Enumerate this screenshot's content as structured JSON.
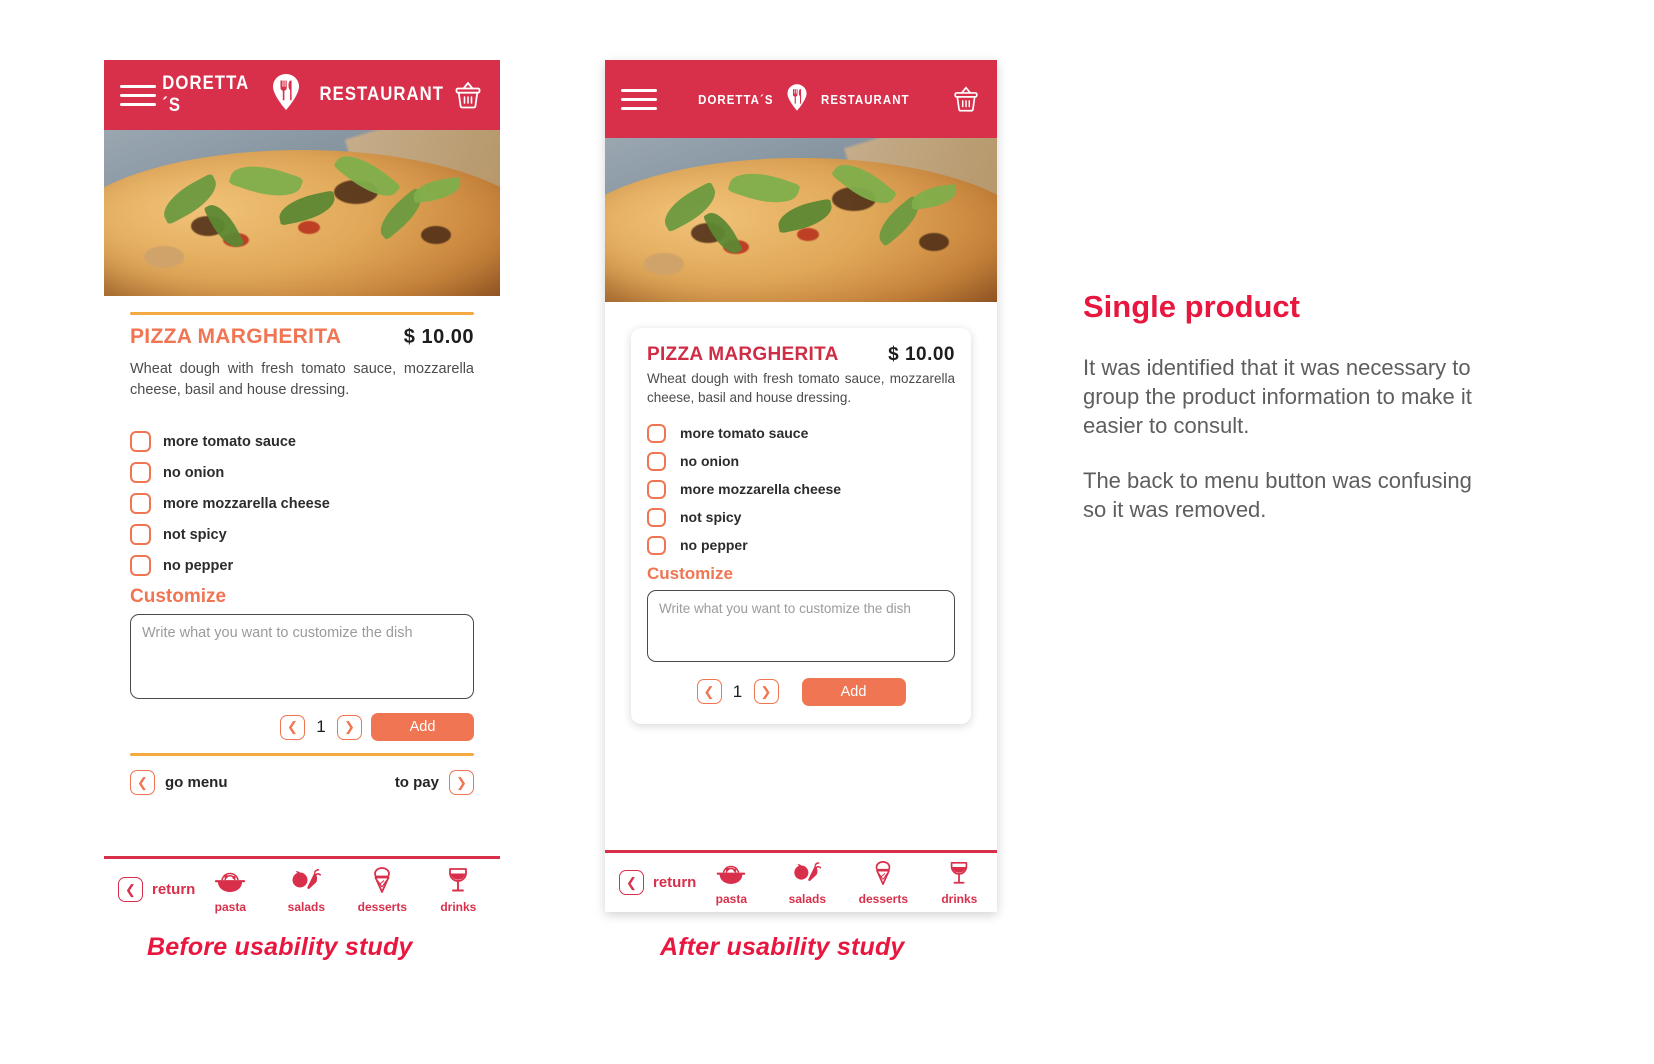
{
  "app": {
    "brand_left": "DORETTA´S",
    "brand_right": "RESTAURANT",
    "menu_icon": "hamburger-menu-icon",
    "cart_icon": "basket-icon",
    "logo_icon": "fork-knife-pin-icon"
  },
  "product": {
    "title": "PIZZA MARGHERITA",
    "price": "$ 10.00",
    "description": "Wheat dough with fresh tomato sauce, mozzarella cheese, basil and house dressing.",
    "options": [
      "more tomato sauce",
      "no onion",
      "more mozzarella cheese",
      "not spicy",
      "no pepper"
    ],
    "customize_label": "Customize",
    "customize_placeholder": "Write what you want to customize the dish",
    "customize_value": "",
    "quantity": "1",
    "add_label": "Add",
    "prev_icon": "chevron-left-icon",
    "next_icon": "chevron-right-icon"
  },
  "before_nav": {
    "go_menu": "go menu",
    "to_pay": "to pay"
  },
  "bottom_nav": {
    "return_label": "return",
    "items": [
      {
        "label": "pasta",
        "icon": "pasta-bowl-icon"
      },
      {
        "label": "salads",
        "icon": "tomato-carrot-icon"
      },
      {
        "label": "desserts",
        "icon": "ice-cream-cone-icon"
      },
      {
        "label": "drinks",
        "icon": "wine-glass-icon"
      }
    ]
  },
  "captions": {
    "before": "Before usability study",
    "after": "After usability study"
  },
  "notes": {
    "heading": "Single product",
    "paragraph1": "It was identified that it was necessary to group the product information to make it easier to consult.",
    "paragraph2": "The back to menu button was confusing so it was removed."
  },
  "colors": {
    "brand_red": "#d8304b",
    "caption_red": "#e8173f",
    "accent_orange": "#f07552",
    "rule_orange": "#f5a941",
    "after_title_red": "#cf2c46",
    "body_gray": "#5e5e5e"
  }
}
